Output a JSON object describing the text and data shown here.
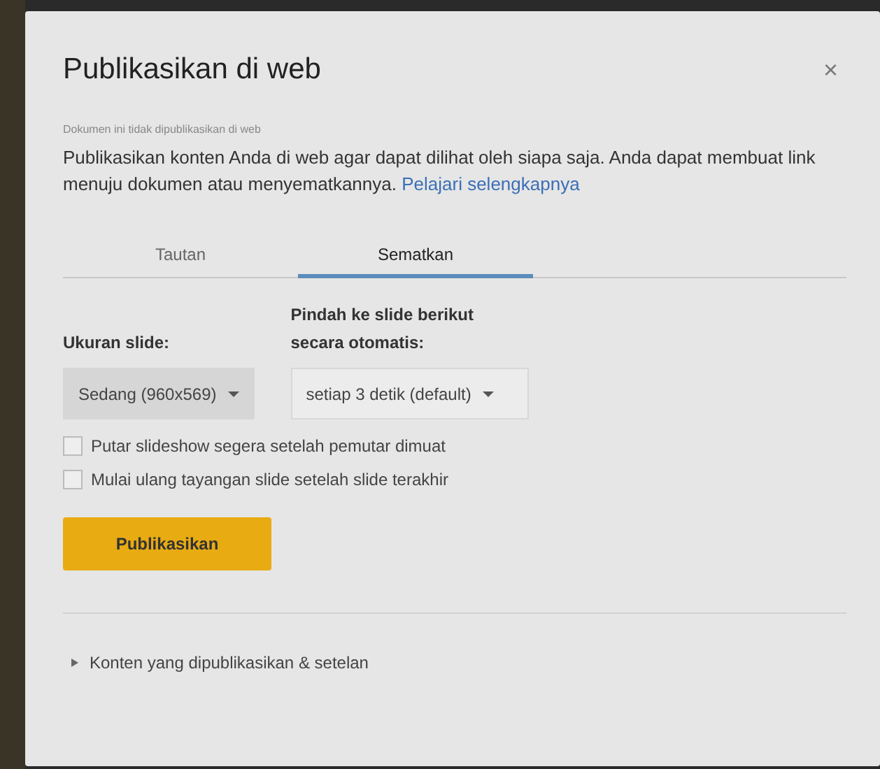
{
  "dialog": {
    "title": "Publikasikan di web",
    "close": "×",
    "status": "Dokumen ini tidak dipublikasikan di web",
    "description": "Publikasikan konten Anda di web agar dapat dilihat oleh siapa saja. Anda dapat membuat link menuju dokumen atau menyematkannya.",
    "learn_more": "Pelajari selengkapnya"
  },
  "tabs": [
    {
      "label": "Tautan",
      "selected": false
    },
    {
      "label": "Sematkan",
      "selected": true
    }
  ],
  "dropdowns": [
    {
      "label": "Ukuran slide:",
      "value": "Sedang (960x569)",
      "highlighted": true
    },
    {
      "label": "Pindah ke slide berikut secara otomatis:",
      "value": "setiap 3 detik (default)",
      "highlighted": false
    }
  ],
  "checkboxes": [
    {
      "label": "Putar slideshow segera setelah pemutar dimuat",
      "checked": false
    },
    {
      "label": "Mulai ulang tayangan slide setelah slide terakhir",
      "checked": false
    }
  ],
  "publish_button": "Publikasikan",
  "settings_section": {
    "label": "Konten yang dipublikasikan & setelan",
    "expanded": false
  }
}
